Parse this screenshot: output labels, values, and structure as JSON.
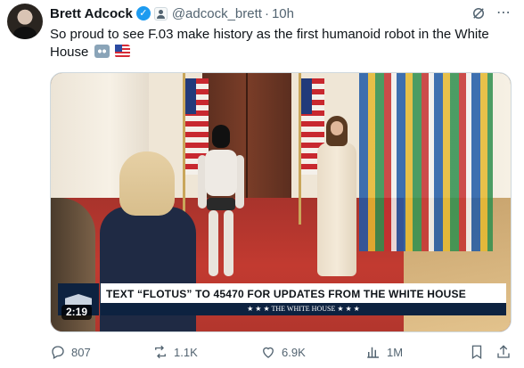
{
  "author": {
    "name": "Brett Adcock",
    "handle": "@adcock_brett",
    "time": "10h",
    "separator": "·",
    "verified_icon": "verified-badge-icon",
    "affiliation_icon": "affiliate-badge-icon"
  },
  "header_icons": {
    "grok": "grok-icon",
    "more": "more-icon",
    "more_glyph": "⋯"
  },
  "tweet": {
    "text": "So proud to see F.03 make history as the first humanoid robot in the White House",
    "emojis": [
      "robot-emoji",
      "us-flag-emoji"
    ]
  },
  "media": {
    "caption_main": "TEXT “FLOTUS” TO 45470 FOR UPDATES FROM THE WHITE HOUSE",
    "caption_sub": "★ ★ ★   THE WHITE HOUSE   ★ ★ ★",
    "duration": "2:19"
  },
  "actions": {
    "replies": "807",
    "reposts": "1.1K",
    "likes": "6.9K",
    "views": "1M"
  },
  "colors": {
    "text_primary": "#0f1419",
    "text_secondary": "#536471",
    "verified": "#1d9bf0",
    "banner_navy": "#0d2240"
  }
}
